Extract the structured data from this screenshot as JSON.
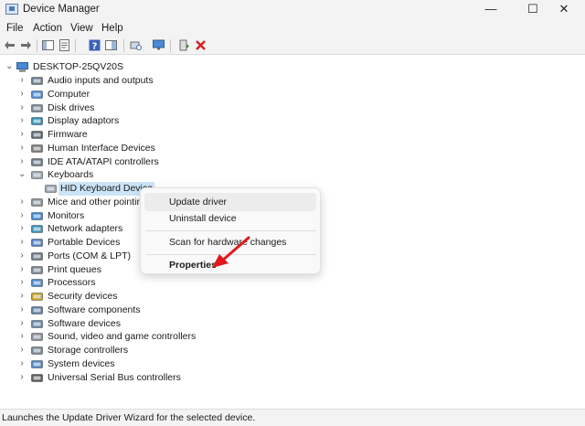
{
  "window": {
    "title": "Device Manager",
    "minimize_glyph": "—",
    "maximize_glyph": "☐",
    "close_glyph": "✕"
  },
  "menu": [
    "File",
    "Action",
    "View",
    "Help"
  ],
  "toolbar": {
    "icons": [
      "back-arrow-icon",
      "forward-arrow-icon",
      "show-hide-console-tree-icon",
      "properties-sheet-icon",
      "help-icon",
      "action-pane-icon",
      "scan-hardware-icon",
      "monitor-icon",
      "update-driver-icon",
      "uninstall-device-icon"
    ]
  },
  "tree": {
    "root": "DESKTOP-25QV20S",
    "items": [
      {
        "label": "Audio inputs and outputs",
        "icon": "speaker-icon"
      },
      {
        "label": "Computer",
        "icon": "computer-icon"
      },
      {
        "label": "Disk drives",
        "icon": "disk-drive-icon"
      },
      {
        "label": "Display adaptors",
        "icon": "display-adapter-icon"
      },
      {
        "label": "Firmware",
        "icon": "firmware-icon"
      },
      {
        "label": "Human Interface Devices",
        "icon": "hid-icon"
      },
      {
        "label": "IDE ATA/ATAPI controllers",
        "icon": "ide-controller-icon"
      },
      {
        "label": "Keyboards",
        "icon": "keyboard-icon",
        "expanded": true
      },
      {
        "label": "HID Keyboard Device",
        "icon": "keyboard-icon",
        "child": true,
        "selected": true
      },
      {
        "label": "Mice and other pointing devices",
        "icon": "mouse-icon"
      },
      {
        "label": "Monitors",
        "icon": "monitor-icon"
      },
      {
        "label": "Network adapters",
        "icon": "network-adapter-icon"
      },
      {
        "label": "Portable Devices",
        "icon": "portable-device-icon"
      },
      {
        "label": "Ports (COM & LPT)",
        "icon": "port-icon"
      },
      {
        "label": "Print queues",
        "icon": "printer-icon"
      },
      {
        "label": "Processors",
        "icon": "processor-icon"
      },
      {
        "label": "Security devices",
        "icon": "security-device-icon"
      },
      {
        "label": "Software components",
        "icon": "software-component-icon"
      },
      {
        "label": "Software devices",
        "icon": "software-device-icon"
      },
      {
        "label": "Sound, video and game controllers",
        "icon": "sound-controller-icon"
      },
      {
        "label": "Storage controllers",
        "icon": "storage-controller-icon"
      },
      {
        "label": "System devices",
        "icon": "system-device-icon"
      },
      {
        "label": "Universal Serial Bus controllers",
        "icon": "usb-icon"
      }
    ]
  },
  "context_menu": {
    "update_driver": "Update driver",
    "uninstall_device": "Uninstall device",
    "scan_hardware": "Scan for hardware changes",
    "properties": "Properties"
  },
  "annotation": {
    "arrow_color": "#e0191f"
  },
  "status": "Launches the Update Driver Wizard for the selected device.",
  "colors": {
    "accent": "#2b6fd6",
    "selection": "#cce4f7",
    "delete": "#d81e1e",
    "update": "#2a8a2a"
  }
}
